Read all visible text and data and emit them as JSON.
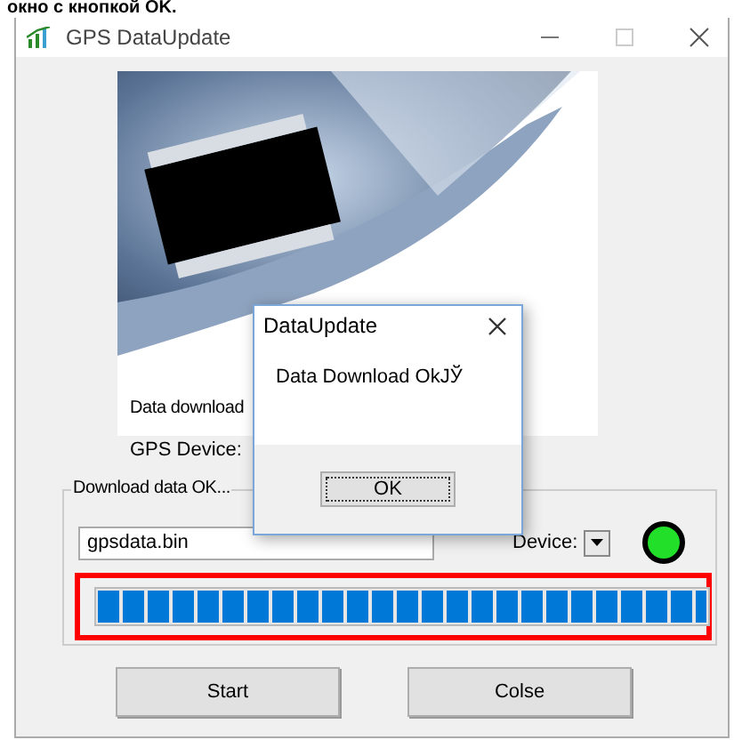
{
  "caption": "окно с кнопкой OK.",
  "window": {
    "title": "GPS DataUpdate"
  },
  "labels": [
    "Data download",
    "GPS Device:"
  ],
  "group": {
    "title": "Download data OK...",
    "file": "gpsdata.bin",
    "device_label": "Device:",
    "led_on": true,
    "progress": {
      "level": 1.0
    }
  },
  "buttons": [
    "Start",
    "Colse"
  ],
  "dialog": {
    "title": "DataUpdate",
    "message": "Data Download OkJЎ",
    "button": "OK"
  }
}
